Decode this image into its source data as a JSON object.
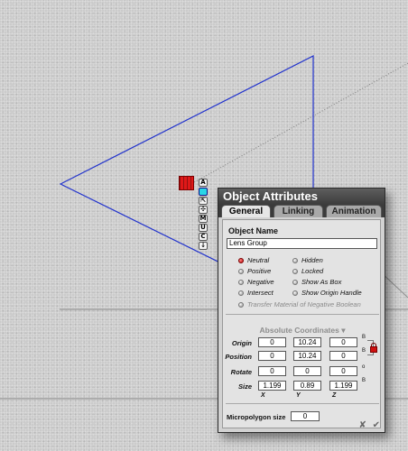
{
  "canvas": {
    "toolbar_buttons": [
      {
        "icon": "A",
        "name": "arrange-tool"
      },
      {
        "icon": "",
        "name": "color-swatch",
        "active": true
      },
      {
        "icon": "⇱",
        "name": "resize-tool"
      },
      {
        "icon": "✣",
        "name": "move-tool"
      },
      {
        "icon": "M",
        "name": "material-tool"
      },
      {
        "icon": "U",
        "name": "ungroup-tool"
      },
      {
        "icon": "C",
        "name": "copy-tool"
      },
      {
        "icon": "↓",
        "name": "drop-tool"
      }
    ]
  },
  "panel": {
    "title": "Object Attributes",
    "tabs": [
      {
        "label": "General",
        "active": true
      },
      {
        "label": "Linking",
        "active": false
      },
      {
        "label": "Animation",
        "active": false
      }
    ],
    "object_name_label": "Object Name",
    "object_name_value": "Lens Group",
    "options_left": [
      {
        "label": "Neutral",
        "selected": true
      },
      {
        "label": "Positive",
        "selected": false
      },
      {
        "label": "Negative",
        "selected": false
      },
      {
        "label": "Intersect",
        "selected": false
      }
    ],
    "options_right": [
      {
        "label": "Hidden"
      },
      {
        "label": "Locked"
      },
      {
        "label": "Show As Box"
      },
      {
        "label": "Show Origin Handle"
      }
    ],
    "transfer_material": "Transfer Material of Negative Boolean",
    "coordinates_header": "Absolute Coordinates",
    "rows": [
      {
        "label": "Origin",
        "values": [
          "0",
          "10.24",
          "0"
        ],
        "suffix": "B"
      },
      {
        "label": "Position",
        "values": [
          "0",
          "10.24",
          "0"
        ],
        "suffix": "B"
      },
      {
        "label": "Rotate",
        "values": [
          "0",
          "0",
          "0"
        ],
        "suffix": "o"
      },
      {
        "label": "Size",
        "values": [
          "1.199",
          "0.89",
          "1.199"
        ],
        "suffix": "B"
      }
    ],
    "axes": [
      "X",
      "Y",
      "Z"
    ],
    "micropolygon_label": "Micropolygon size",
    "micropolygon_value": "0",
    "footer_close": "✘",
    "footer_ok": "✔"
  }
}
